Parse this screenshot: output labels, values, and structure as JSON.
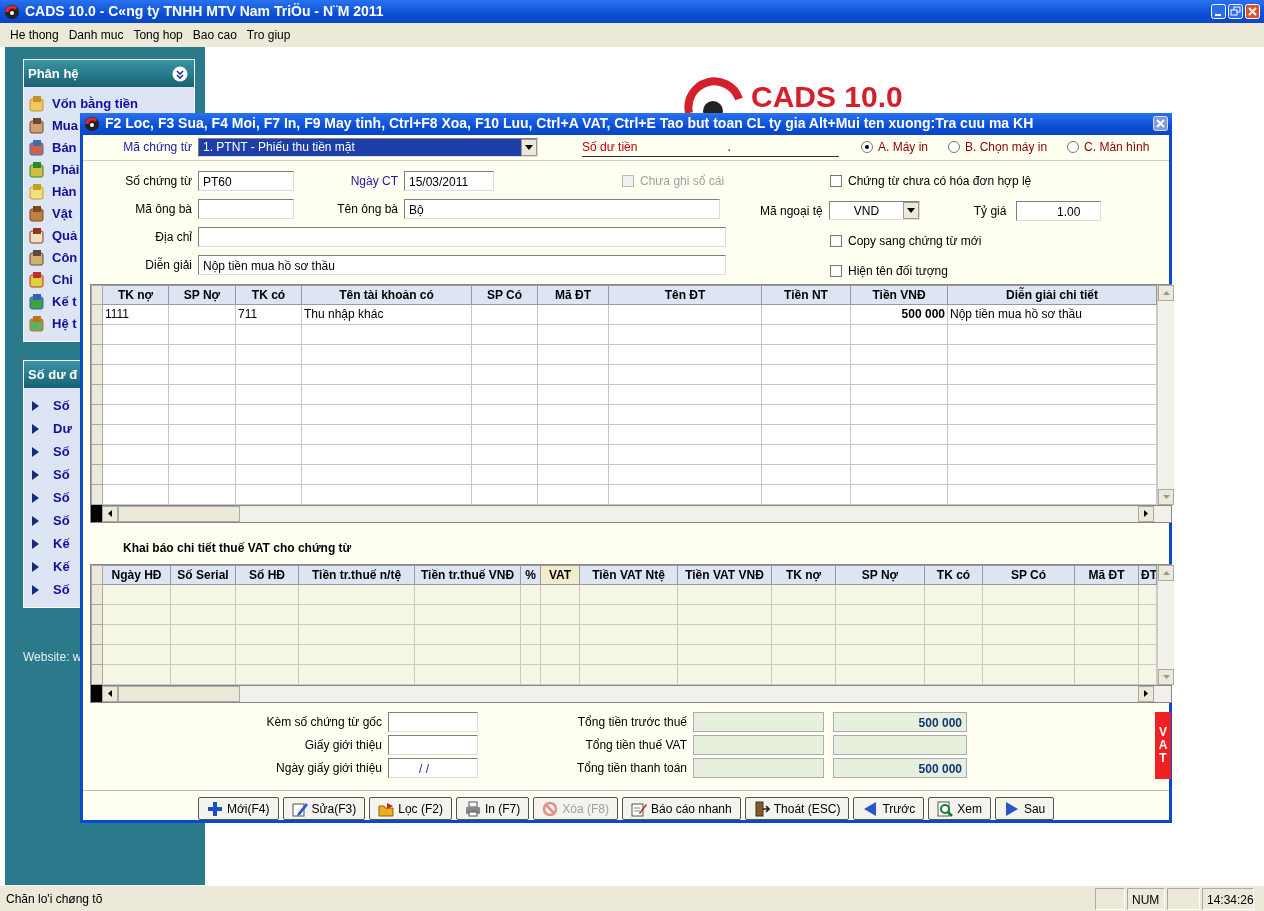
{
  "window": {
    "title": "CADS 10.0 - C«ng ty TNHH MTV Nam TriÖu - N¨M 2011"
  },
  "menu": [
    {
      "label": "He thong"
    },
    {
      "label": "Danh muc"
    },
    {
      "label": "Tong hop"
    },
    {
      "label": "Bao cao"
    },
    {
      "label": "Tro giup"
    }
  ],
  "sidebar": {
    "panels": [
      {
        "title": "Phân hệ",
        "kind": "modules",
        "items": [
          {
            "label": "Vốn bằng tiền"
          },
          {
            "label": "Mua"
          },
          {
            "label": "Bán"
          },
          {
            "label": "Phải"
          },
          {
            "label": "Hàn"
          },
          {
            "label": "Vật"
          },
          {
            "label": "Quả"
          },
          {
            "label": "Côn"
          },
          {
            "label": "Chi"
          },
          {
            "label": "Kế t"
          },
          {
            "label": "Hệ t"
          }
        ]
      },
      {
        "title": "Số dư đ",
        "kind": "links",
        "items": [
          {
            "label": "Số"
          },
          {
            "label": "Dư"
          },
          {
            "label": "Số"
          },
          {
            "label": "Số"
          },
          {
            "label": "Số"
          },
          {
            "label": "Số"
          },
          {
            "label": "Kế"
          },
          {
            "label": "Kế"
          },
          {
            "label": "Số"
          }
        ]
      }
    ],
    "website": "Website: w"
  },
  "logo": {
    "text": "CADS 10.0"
  },
  "dialog": {
    "title": "F2 Loc, F3 Sua, F4 Moi, F7 In, F9 May tinh, Ctrl+F8 Xoa, F10 Luu, Ctrl+A VAT, Ctrl+E Tao but toan CL ty gia Alt+Mui ten xuong:Tra cuu ma KH",
    "voucher_type": {
      "label": "Mã chứng từ",
      "value": "1. PTNT - Phiếu thu tiền mặt",
      "required": true
    },
    "balance": {
      "label": "Số dư tiền",
      "value": "."
    },
    "output_options": [
      {
        "label": "A. Máy in",
        "selected": true
      },
      {
        "label": "B. Chọn máy in",
        "selected": false
      },
      {
        "label": "C. Màn hình",
        "selected": false
      }
    ],
    "form_rows": [
      {
        "fields": [
          {
            "label": "Số chứng từ",
            "value": "PT60",
            "required": false
          },
          {
            "label": "Ngày CT",
            "value": "15/03/2011",
            "required": true
          }
        ],
        "checkbox": {
          "label": "Chưa ghi sổ cái",
          "checked": false,
          "disabled": true
        }
      },
      {
        "fields": [
          {
            "label": "Mã ông bà",
            "required": false
          },
          {
            "label": "Tên ông bà",
            "value": "Bộ",
            "required": false
          }
        ]
      },
      {
        "fields": [
          {
            "label": "Địa chỉ",
            "required": false
          }
        ]
      },
      {
        "fields": [
          {
            "label": "Diễn giải",
            "value": "Nộp tiền mua hồ sơ thầu",
            "required": false
          }
        ]
      }
    ],
    "side_items": [
      {
        "kind": "checkbox",
        "label": "Chứng từ chưa có hóa đơn hợp lệ",
        "checked": false
      },
      {
        "kind": "currency",
        "label": "Mã ngoại tệ",
        "value": "VND",
        "rate_label": "Tỷ giá",
        "rate_value": "1.00"
      },
      {
        "kind": "checkbox",
        "label": "Copy sang chứng từ mới",
        "checked": false
      },
      {
        "kind": "checkbox",
        "label": "Hiện tên đối tượng",
        "checked": false
      }
    ],
    "entries_table": {
      "columns": [
        {
          "label": "TK nợ"
        },
        {
          "label": "SP Nợ"
        },
        {
          "label": "TK có"
        },
        {
          "label": "Tên tài khoản có"
        },
        {
          "label": "SP Có"
        },
        {
          "label": "Mã ĐT"
        },
        {
          "label": "Tên ĐT"
        },
        {
          "label": "Tiền NT"
        },
        {
          "label": "Tiền VNĐ"
        },
        {
          "label": "Diễn giải chi tiết"
        }
      ],
      "rows": [
        {
          "cells": [
            {
              "text": "1111",
              "kind": "text"
            },
            null,
            {
              "text": "711",
              "kind": "text"
            },
            {
              "text": "Thu nhập khác",
              "kind": "text"
            },
            null,
            null,
            null,
            null,
            {
              "text": "500 000",
              "kind": "amount"
            },
            {
              "text": "Nộp tiền mua hồ sơ thầu",
              "kind": "text"
            }
          ]
        }
      ]
    },
    "vat_section": {
      "title": "Khai báo chi tiết thuế VAT cho chứng từ",
      "columns": [
        {
          "label": "Ngày HĐ",
          "highlighted": false
        },
        {
          "label": "Số Serial",
          "highlighted": false
        },
        {
          "label": "Số HĐ",
          "highlighted": false
        },
        {
          "label": "Tiền tr.thuế n/tệ",
          "highlighted": false
        },
        {
          "label": "Tiền tr.thuế VNĐ",
          "highlighted": false
        },
        {
          "label": "%",
          "highlighted": false
        },
        {
          "label": "VAT",
          "highlighted": true
        },
        {
          "label": "Tiền VAT Ntệ",
          "highlighted": false
        },
        {
          "label": "Tiền VAT VNĐ",
          "highlighted": false
        },
        {
          "label": "TK nợ",
          "highlighted": false
        },
        {
          "label": "SP Nợ",
          "highlighted": false
        },
        {
          "label": "TK có",
          "highlighted": false
        },
        {
          "label": "SP Có",
          "highlighted": false
        },
        {
          "label": "Mã ĐT",
          "highlighted": false
        },
        {
          "label": "ĐT",
          "highlighted": false
        }
      ]
    },
    "attachments": [
      {
        "label": "Kèm số chứng từ gốc",
        "kind": "text"
      },
      {
        "label": "Giấy giới thiệu",
        "kind": "text"
      },
      {
        "label": "Ngày giấy giới thiệu",
        "kind": "date",
        "value": "/ /"
      }
    ],
    "totals": [
      {
        "label": "Tổng tiền trước thuế",
        "value": "500 000"
      },
      {
        "label": "Tổng tiền thuế VAT"
      },
      {
        "label": "Tổng tiền thanh toán",
        "value": "500 000"
      }
    ],
    "vat_button": {
      "label": "VAT"
    },
    "buttons": [
      {
        "label": "Mới(F4)",
        "disabled": false
      },
      {
        "label": "Sửa(F3)",
        "disabled": false
      },
      {
        "label": "Lọc (F2)",
        "disabled": false
      },
      {
        "label": "In (F7)",
        "disabled": false
      },
      {
        "label": "Xóa (F8)",
        "disabled": true
      },
      {
        "label": "Báo cáo nhanh",
        "disabled": false
      },
      {
        "label": "Thoát (ESC)",
        "disabled": false
      },
      {
        "label": "Trước",
        "disabled": false
      },
      {
        "label": "Xem",
        "disabled": false
      },
      {
        "label": "Sau",
        "disabled": false
      }
    ]
  },
  "status_bar": {
    "message": "Chăn lo'i chøng tõ",
    "panels": [
      "NUM",
      "14:34:26"
    ]
  }
}
